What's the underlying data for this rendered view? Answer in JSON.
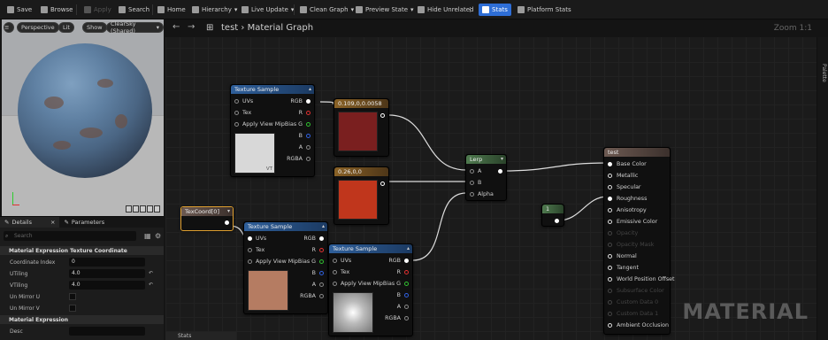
{
  "toolbar": {
    "save": "Save",
    "browse": "Browse",
    "apply": "Apply",
    "search": "Search",
    "home": "Home",
    "hierarchy": "Hierarchy",
    "live_update": "Live Update",
    "clean_graph": "Clean Graph",
    "preview_state": "Preview State",
    "hide_unrelated": "Hide Unrelated",
    "stats": "Stats",
    "platform_stats": "Platform Stats"
  },
  "viewport": {
    "perspective": "Perspective",
    "lit": "Lit",
    "show": "Show",
    "sky": "ClearSky (Shared)"
  },
  "details": {
    "tab_details": "Details",
    "tab_parameters": "Parameters",
    "search_placeholder": "Search",
    "section1": "Material Expression Texture Coordinate",
    "rows": [
      {
        "label": "Coordinate Index",
        "value": "0"
      },
      {
        "label": "UTiling",
        "value": "4.0"
      },
      {
        "label": "VTiling",
        "value": "4.0"
      },
      {
        "label": "Un Mirror U",
        "value": ""
      },
      {
        "label": "Un Mirror V",
        "value": ""
      }
    ],
    "section2": "Material Expression",
    "desc_label": "Desc"
  },
  "graph": {
    "breadcrumb": "test",
    "title": "Material Graph",
    "zoom": "Zoom 1:1",
    "palette": "Palette",
    "logo": "MATERIAL",
    "stats_tab": "Stats"
  },
  "nodes": {
    "ts1": {
      "title": "Texture Sample",
      "pins_in": [
        "UVs",
        "Tex",
        "Apply View MipBias"
      ],
      "pins_out": [
        "RGB",
        "R",
        "G",
        "B",
        "A",
        "RGBA"
      ],
      "vt": "VT"
    },
    "ts2": {
      "title": "Texture Sample",
      "pins_in": [
        "UVs",
        "Tex",
        "Apply View MipBias"
      ],
      "pins_out": [
        "RGB",
        "R",
        "G",
        "B",
        "A",
        "RGBA"
      ]
    },
    "ts3": {
      "title": "Texture Sample",
      "pins_in": [
        "UVs",
        "Tex",
        "Apply View MipBias"
      ],
      "pins_out": [
        "RGB",
        "R",
        "G",
        "B",
        "A",
        "RGBA"
      ]
    },
    "c1": {
      "title": "0.109,0,0.0058"
    },
    "c2": {
      "title": "0.26,0,0"
    },
    "texcoord": {
      "title": "TexCoord[0]"
    },
    "lerp": {
      "title": "Lerp",
      "pins_in": [
        "A",
        "B",
        "Alpha"
      ]
    },
    "const": {
      "title": "1"
    },
    "result": {
      "title": "test",
      "pins": [
        "Base Color",
        "Metallic",
        "Specular",
        "Roughness",
        "Anisotropy",
        "Emissive Color",
        "Opacity",
        "Opacity Mask",
        "Normal",
        "Tangent",
        "World Position Offset",
        "Subsurface Color",
        "Custom Data 0",
        "Custom Data 1",
        "Ambient Occlusion"
      ]
    }
  },
  "colors": {
    "swatch1": "#7a1f1f",
    "swatch2": "#c0361c",
    "accent": "#2e6ed6"
  }
}
